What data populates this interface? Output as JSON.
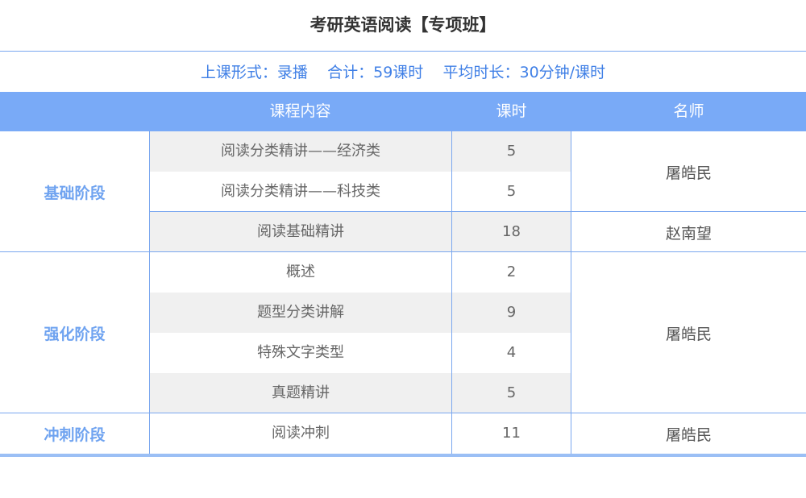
{
  "title": "考研英语阅读【专项班】",
  "info": {
    "format_label": "上课形式：",
    "format_value": "录播",
    "total_label": "合计：",
    "total_value": "59课时",
    "avg_label": "平均时长：",
    "avg_value": "30分钟/课时"
  },
  "headers": {
    "content": "课程内容",
    "hours": "课时",
    "teacher": "名师"
  },
  "stages": [
    {
      "name": "基础阶段",
      "rows": [
        {
          "content": "阅读分类精讲——经济类",
          "hours": "5"
        },
        {
          "content": "阅读分类精讲——科技类",
          "hours": "5"
        },
        {
          "content": "阅读基础精讲",
          "hours": "18"
        }
      ],
      "teachers": [
        "屠皓民",
        "赵南望"
      ]
    },
    {
      "name": "强化阶段",
      "rows": [
        {
          "content": "概述",
          "hours": "2"
        },
        {
          "content": "题型分类讲解",
          "hours": "9"
        },
        {
          "content": "特殊文字类型",
          "hours": "4"
        },
        {
          "content": "真题精讲",
          "hours": "5"
        }
      ],
      "teachers": [
        "屠皓民"
      ]
    },
    {
      "name": "冲刺阶段",
      "rows": [
        {
          "content": "阅读冲刺",
          "hours": "11"
        }
      ],
      "teachers": [
        "屠皓民"
      ]
    }
  ],
  "colors": {
    "header_bg": "#79aaf7",
    "accent_text": "#3f7fe6",
    "stage_text": "#6fa3f0",
    "grid_line": "#7aa7ef",
    "row_shade": "#f0f0f0"
  }
}
